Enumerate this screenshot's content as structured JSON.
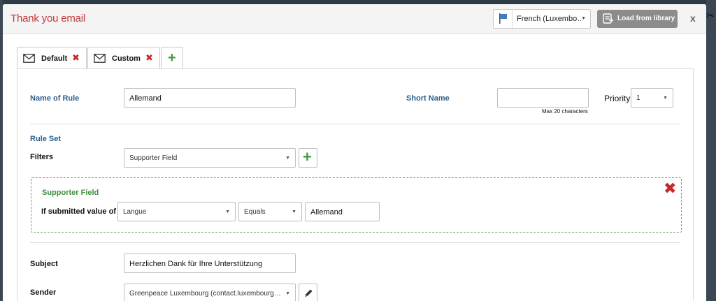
{
  "modal": {
    "title": "Thank you email",
    "language": "French (Luxembo…",
    "load_library_label": "Load from library",
    "close_label": "x"
  },
  "tabs": [
    {
      "label": "Default"
    },
    {
      "label": "Custom"
    }
  ],
  "rule": {
    "name_label": "Name of Rule",
    "name_value": "Allemand",
    "short_name_label": "Short Name",
    "short_name_value": "",
    "short_name_hint": "Max 20 characters",
    "priority_label": "Priority",
    "priority_value": "1"
  },
  "rule_set": {
    "heading": "Rule Set",
    "filters_label": "Filters",
    "filter_type": "Supporter Field"
  },
  "filter": {
    "title": "Supporter Field",
    "condition_label": "If submitted value of",
    "field": "Langue",
    "operator": "Equals",
    "value": "Allemand"
  },
  "email": {
    "subject_label": "Subject",
    "subject_value": "Herzlichen Dank für Ihre Unterstützung",
    "sender_label": "Sender",
    "sender_value": "Greenpeace Luxembourg (contact.luxembourg…"
  },
  "colors": {
    "title": "#c0393b",
    "label_blue": "#2a5f8c",
    "add_green": "#3f9a3f",
    "delete_red": "#c62828",
    "filter_border": "#6aa86a"
  },
  "icons": {
    "flag": "flag-icon",
    "library": "library-icon",
    "mail": "envelope-icon",
    "delete": "delete-x-icon",
    "add": "plus-icon",
    "edit": "pencil-icon"
  }
}
